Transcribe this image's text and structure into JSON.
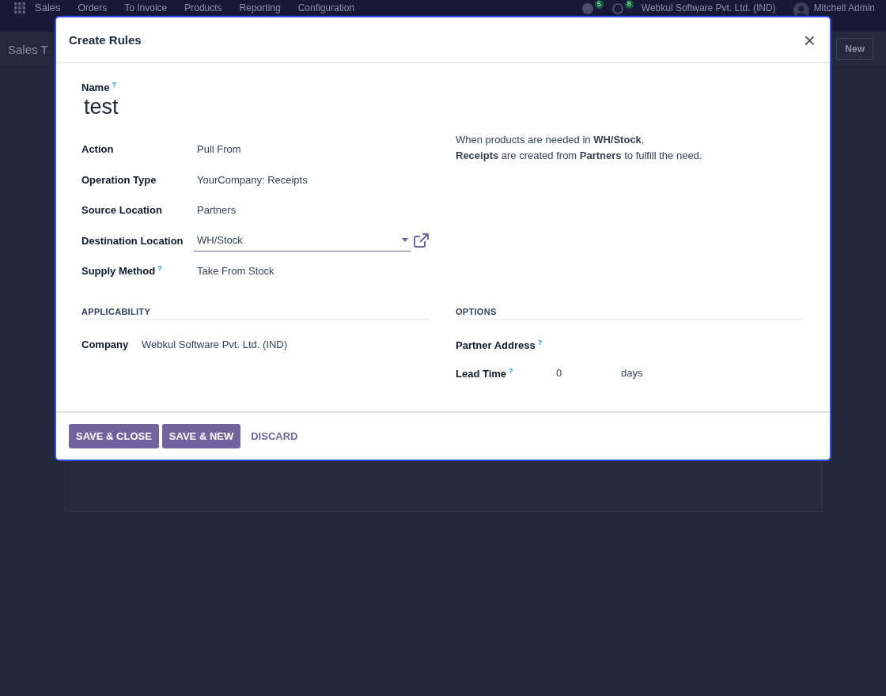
{
  "background": {
    "app_name": "Sales",
    "menu": [
      "Orders",
      "To Invoice",
      "Products",
      "Reporting",
      "Configuration"
    ],
    "activity_count": "5",
    "message_count": "8",
    "company": "Webkul Software Pvt. Ltd. (IND)",
    "user": "Mitchell Admin",
    "page_title": "Sales T",
    "new_button": "New"
  },
  "dialog": {
    "title": "Create Rules",
    "close": "×",
    "name": {
      "label": "Name",
      "help_mark": "?",
      "value": "test"
    },
    "fields": [
      {
        "label": "Action",
        "value": "Pull From",
        "kind": "text"
      },
      {
        "label": "Operation Type",
        "value": "YourCompany: Receipts",
        "kind": "text"
      },
      {
        "label": "Source Location",
        "value": "Partners",
        "kind": "text"
      },
      {
        "label": "Destination Location",
        "value": "WH/Stock",
        "kind": "select"
      },
      {
        "label": "Supply Method",
        "help_mark": "?",
        "value": "Take From Stock",
        "kind": "text"
      }
    ],
    "help_text": [
      "When products are needed in **WH/Stock**,",
      "**Receipts** are created from **Partners** to fulfill the need."
    ],
    "sections": [
      {
        "title": "APPLICABILITY",
        "fields": [
          {
            "label": "Company",
            "value": "Webkul Software Pvt. Ltd. (IND)"
          }
        ]
      },
      {
        "title": "OPTIONS",
        "fields": [
          {
            "label": "Partner Address",
            "help_mark": "?"
          },
          {
            "label": "Lead Time",
            "help_mark": "?",
            "value": "0",
            "unit": "days"
          }
        ]
      }
    ],
    "buttons": [
      {
        "label": "SAVE & CLOSE",
        "kind": "primary"
      },
      {
        "label": "SAVE & NEW",
        "kind": "primary"
      },
      {
        "label": "DISCARD",
        "kind": "link"
      }
    ]
  }
}
